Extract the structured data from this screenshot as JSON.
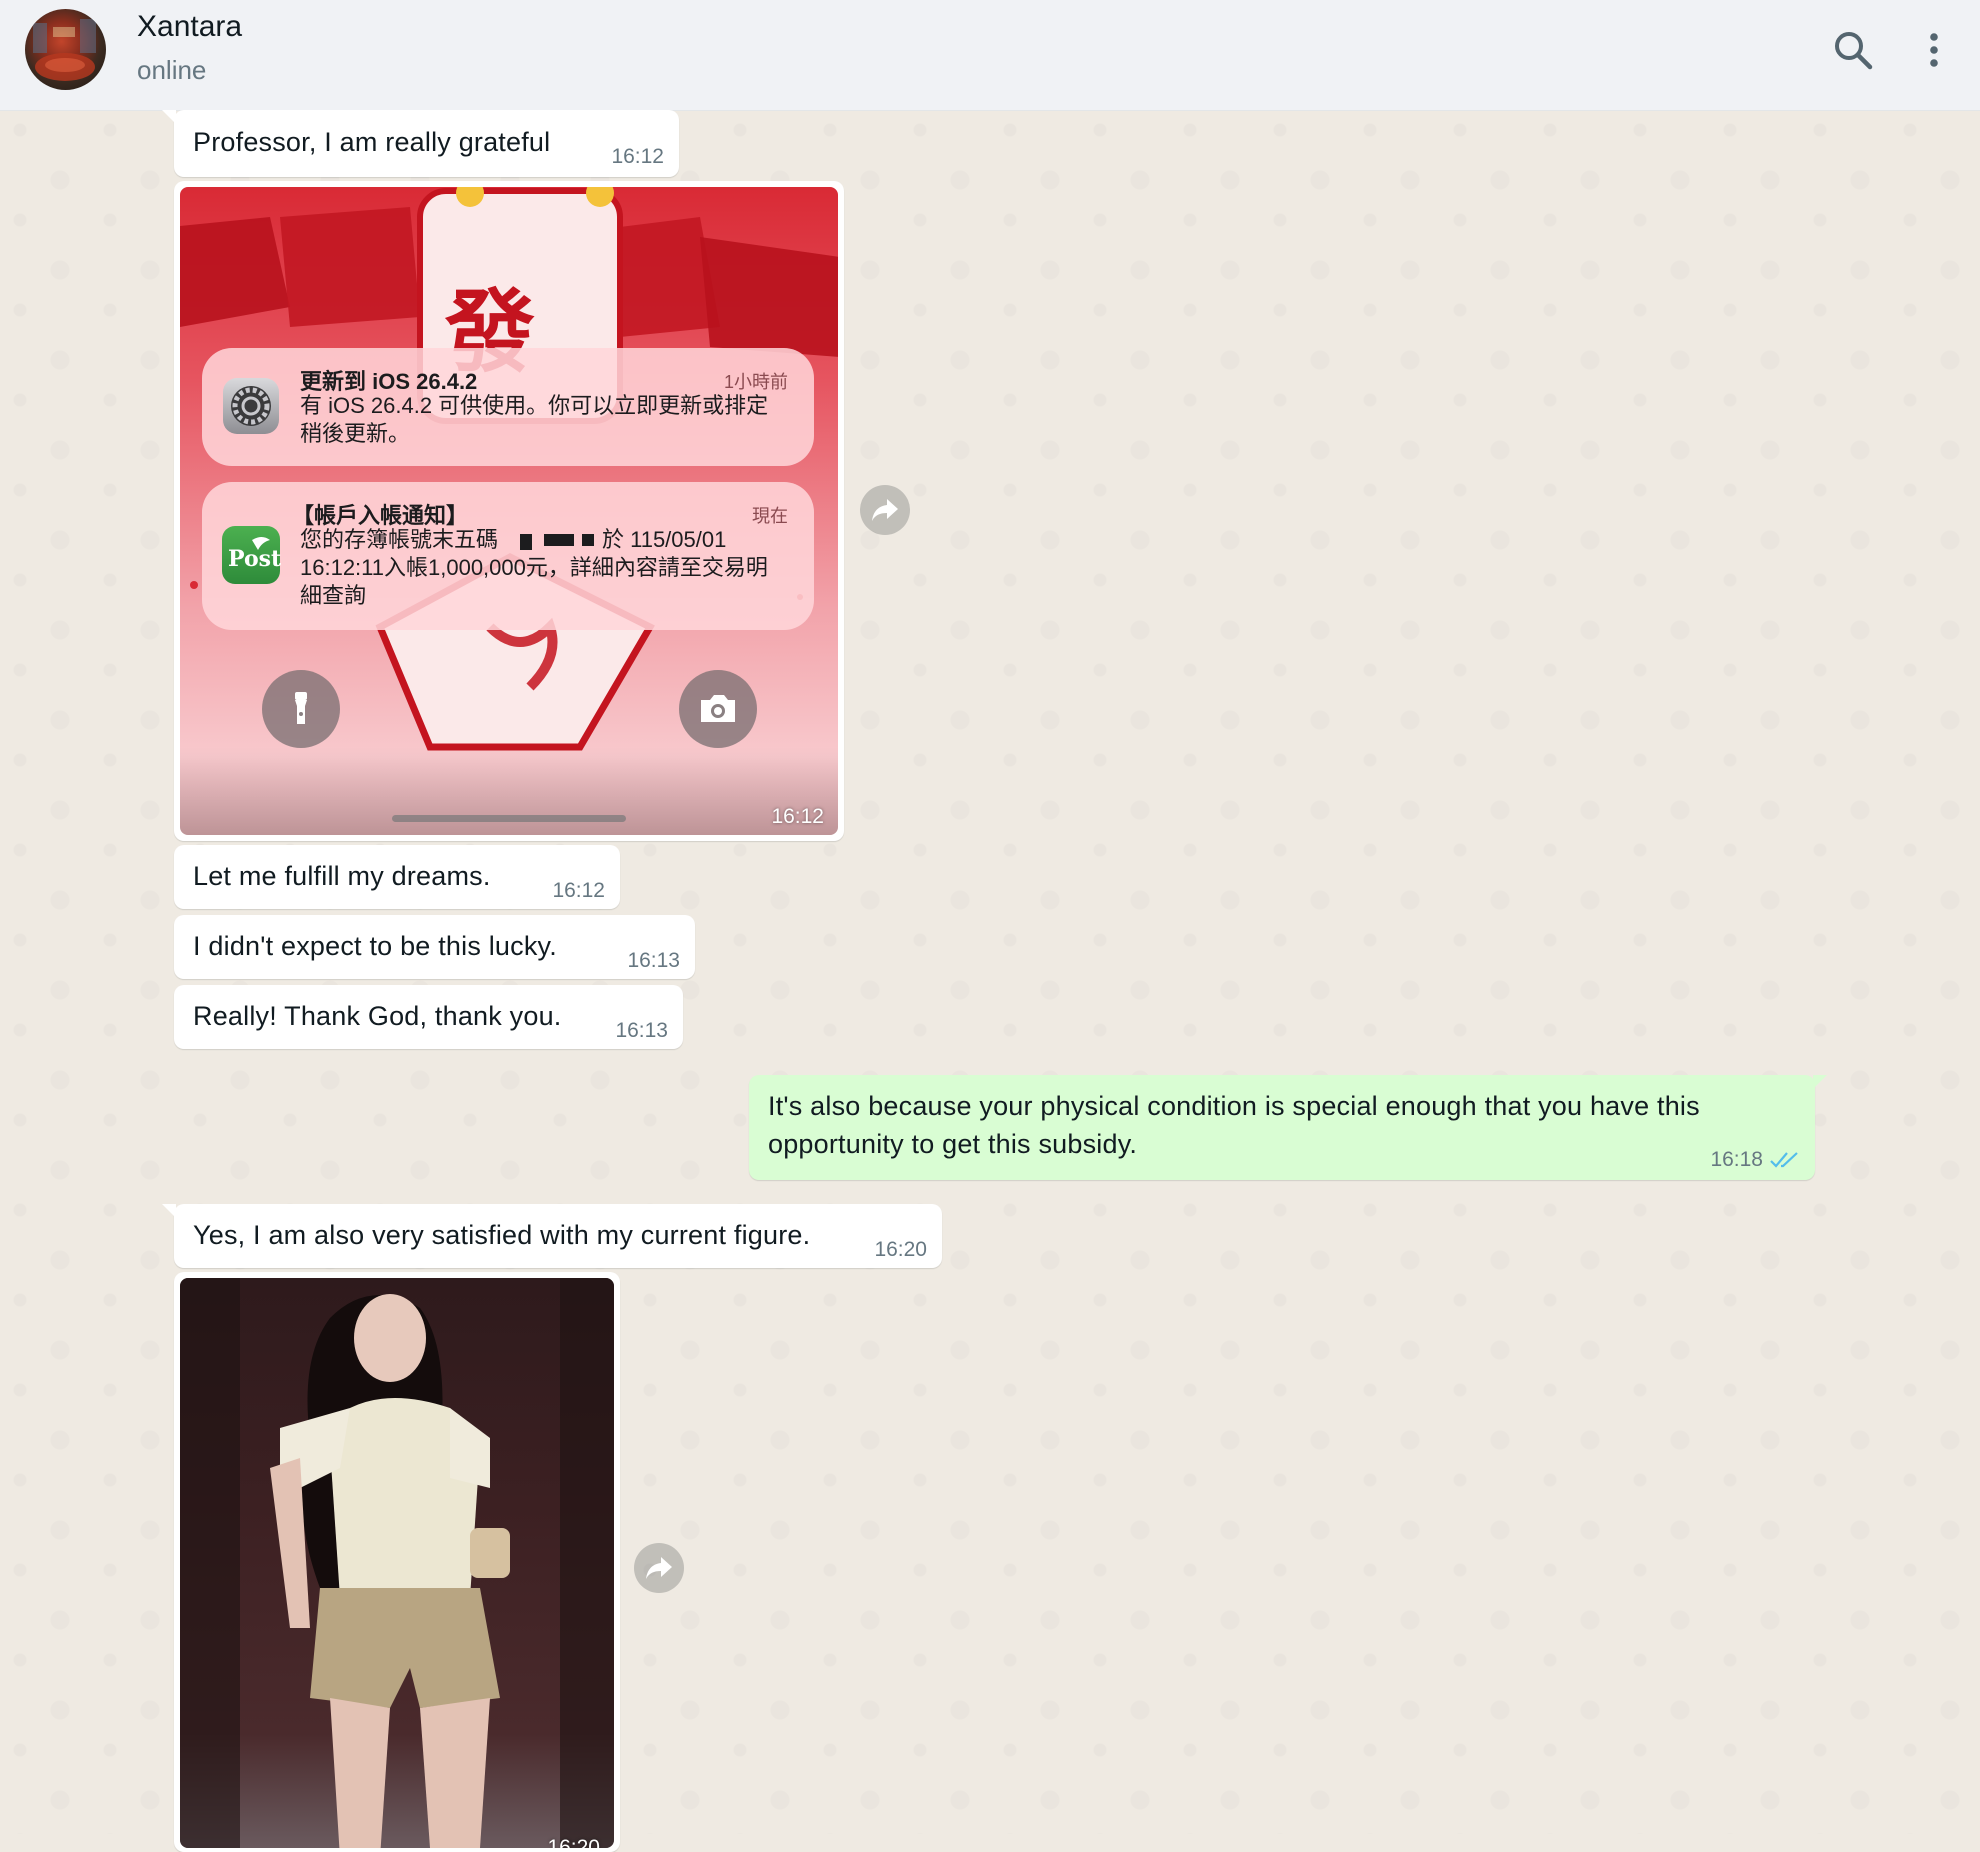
{
  "header": {
    "contact_name": "Xantara",
    "status": "online",
    "search_icon": "search-icon",
    "menu_icon": "more-vertical-icon"
  },
  "messages": [
    {
      "direction": "in",
      "text": "Professor, I am really grateful",
      "time": "16:12"
    },
    {
      "direction": "in",
      "type": "image",
      "time": "16:12",
      "screenshot": {
        "notifications": [
          {
            "icon": "settings-gear-icon",
            "title": "更新到 iOS 26.4.2",
            "time": "1小時前",
            "body_lines": [
              "有 iOS 26.4.2 可供使用。你可以立即更新或排定",
              "稍後更新。"
            ]
          },
          {
            "icon": "post-app-icon",
            "title": "【帳戶入帳通知】",
            "time": "現在",
            "body_lines": [
              "您的存簿帳號末五碼",
              "於 115/05/01",
              "16:12:11入帳1,000,000元，詳細內容請至交易明",
              "細查詢"
            ]
          }
        ],
        "glyph_top": "發",
        "post_icon_text": "Post"
      }
    },
    {
      "direction": "in",
      "text": "Let me fulfill my dreams.",
      "time": "16:12"
    },
    {
      "direction": "in",
      "text": "I didn't expect to be this lucky.",
      "time": "16:13"
    },
    {
      "direction": "in",
      "text": "Really! Thank God, thank you.",
      "time": "16:13"
    },
    {
      "direction": "out",
      "text_lines": [
        "It's also because your physical condition is special enough that you have this",
        "opportunity to get this subsidy."
      ],
      "time": "16:18",
      "status": "read"
    },
    {
      "direction": "in",
      "text": "Yes, I am also very satisfied with my current figure.",
      "time": "16:20"
    },
    {
      "direction": "in",
      "type": "image",
      "time": "16:20"
    }
  ],
  "colors": {
    "chat_bg": "#efeae2",
    "incoming_bubble": "#ffffff",
    "outgoing_bubble": "#d9fdd3",
    "read_ticks": "#53bdeb",
    "header_bg": "#f0f2f5"
  }
}
